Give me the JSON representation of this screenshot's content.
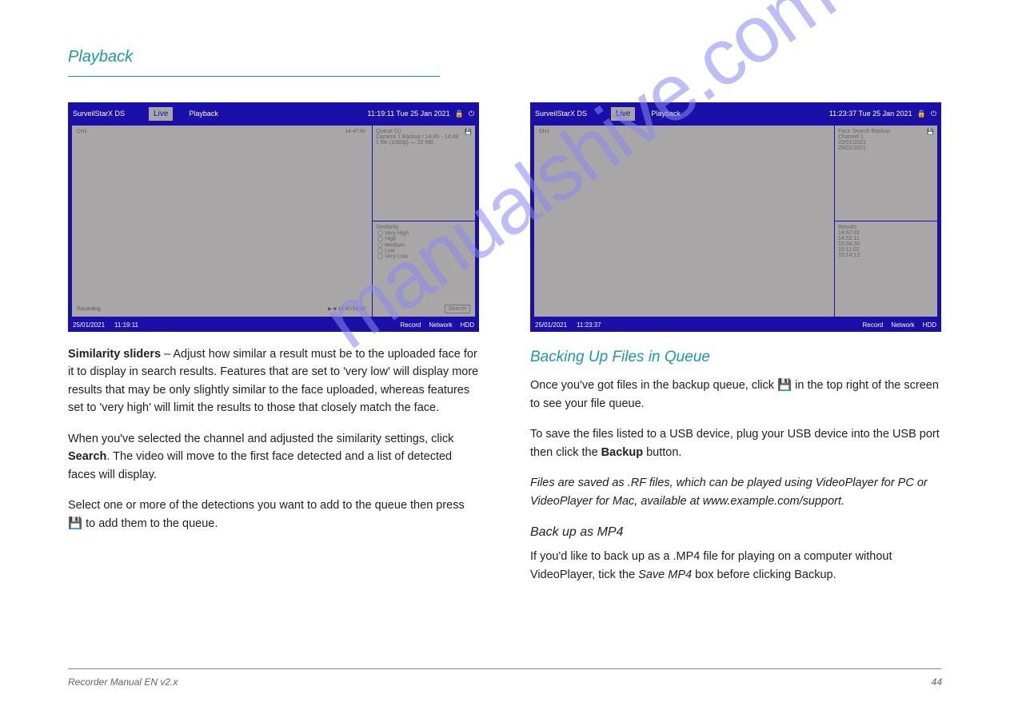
{
  "watermark": "manualshive.com",
  "page_header": "Playback",
  "screenshot_left": {
    "topbar": {
      "title": "SurveilStarX DS",
      "tab_active": "Live",
      "tab_playback": "Playback",
      "clock": "11:19:11 Tue 25 Jan 2021",
      "lock_icon": "lock-icon",
      "power_icon": "power-icon"
    },
    "main": {
      "ch_top_left": "CH1",
      "clock_label": "14:47:00",
      "status": "Recording",
      "ctrl_play": "▶",
      "ctrl_stop": "■",
      "time_current": "14:47/16:30"
    },
    "side_top_header": "Queue (1)",
    "side_top_lines": [
      "Camera 1 Backup / 14:45 - 14:48",
      "1 file (1080p) — 32 MB"
    ],
    "side_bottom_header": "Similarity",
    "similarity_controls": [
      "Very High",
      "High",
      "Medium",
      "Low",
      "Very Low"
    ],
    "search_btn": "Search",
    "status_bar_left_date": "25/01/2021",
    "status_bar_left_time": "11:19:11",
    "status_bar_right": [
      "Record",
      "Network",
      "HDD"
    ]
  },
  "screenshot_right": {
    "topbar": {
      "title": "SurveilStarX DS",
      "tab_active": "Live",
      "tab_playback": "Playback",
      "clock": "11:23:37 Tue 25 Jan 2021",
      "lock_icon": "lock-icon",
      "power_icon": "power-icon"
    },
    "side_top_header": "Face Search Backup",
    "side_top_labels": {
      "chan": "Channel 1",
      "start": "25/01/2021",
      "end": "25/01/2021"
    },
    "side_bottom_header": "Results",
    "result_rows": [
      "14:47:01",
      "14:52:11",
      "15:04:30",
      "15:11:02",
      "15:14:12"
    ],
    "status_bar_left_date": "25/01/2021",
    "status_bar_left_time": "11:23:37",
    "status_bar_right": [
      "Record",
      "Network",
      "HDD"
    ]
  },
  "body_left": {
    "p1_label": "Similarity sliders",
    "p1": " – Adjust how similar a result must be to the uploaded face for it to display in search results. Features that are set to 'very low' will display more results that may be only slightly similar to the face uploaded, whereas features set to 'very high' will limit the results to those that closely match the face.",
    "p2_prefix": "When you've selected the channel and adjusted the similarity settings, click ",
    "p2_btn": "Search",
    "p2_suffix": ". The video will move to the first face detected and a list of detected faces will display.",
    "p3_prefix": "Select one or more of the detections you want to add to the queue then press ",
    "p3_icon_label": "the backup icon",
    "p3_suffix": " to add them to the queue."
  },
  "body_right": {
    "sect_title": "Backing Up Files in Queue",
    "p1_prefix": "Once you've got files in the backup queue, click ",
    "p1_icon_label": "the backup icon",
    "p1_suffix": " in the top right of the screen to see your file queue.",
    "p2_prefix": "To save the files listed to a USB device, plug your USB device into the USB port then click the ",
    "p2_btn": "Backup",
    "p2_suffix": " button.",
    "note": "Files are saved as .RF files, which can be played using VideoPlayer for PC or VideoPlayer for Mac, available at www.example.com/support.",
    "subh": "Back up as MP4",
    "p3_prefix": "If you'd like to back up as a .MP4 file for playing on a computer without VideoPlayer, tick the ",
    "p3_em": "Save MP4",
    "p3_suffix": " box before clicking Backup."
  },
  "footer": {
    "left": "Recorder Manual EN v2.x",
    "right": "44"
  }
}
